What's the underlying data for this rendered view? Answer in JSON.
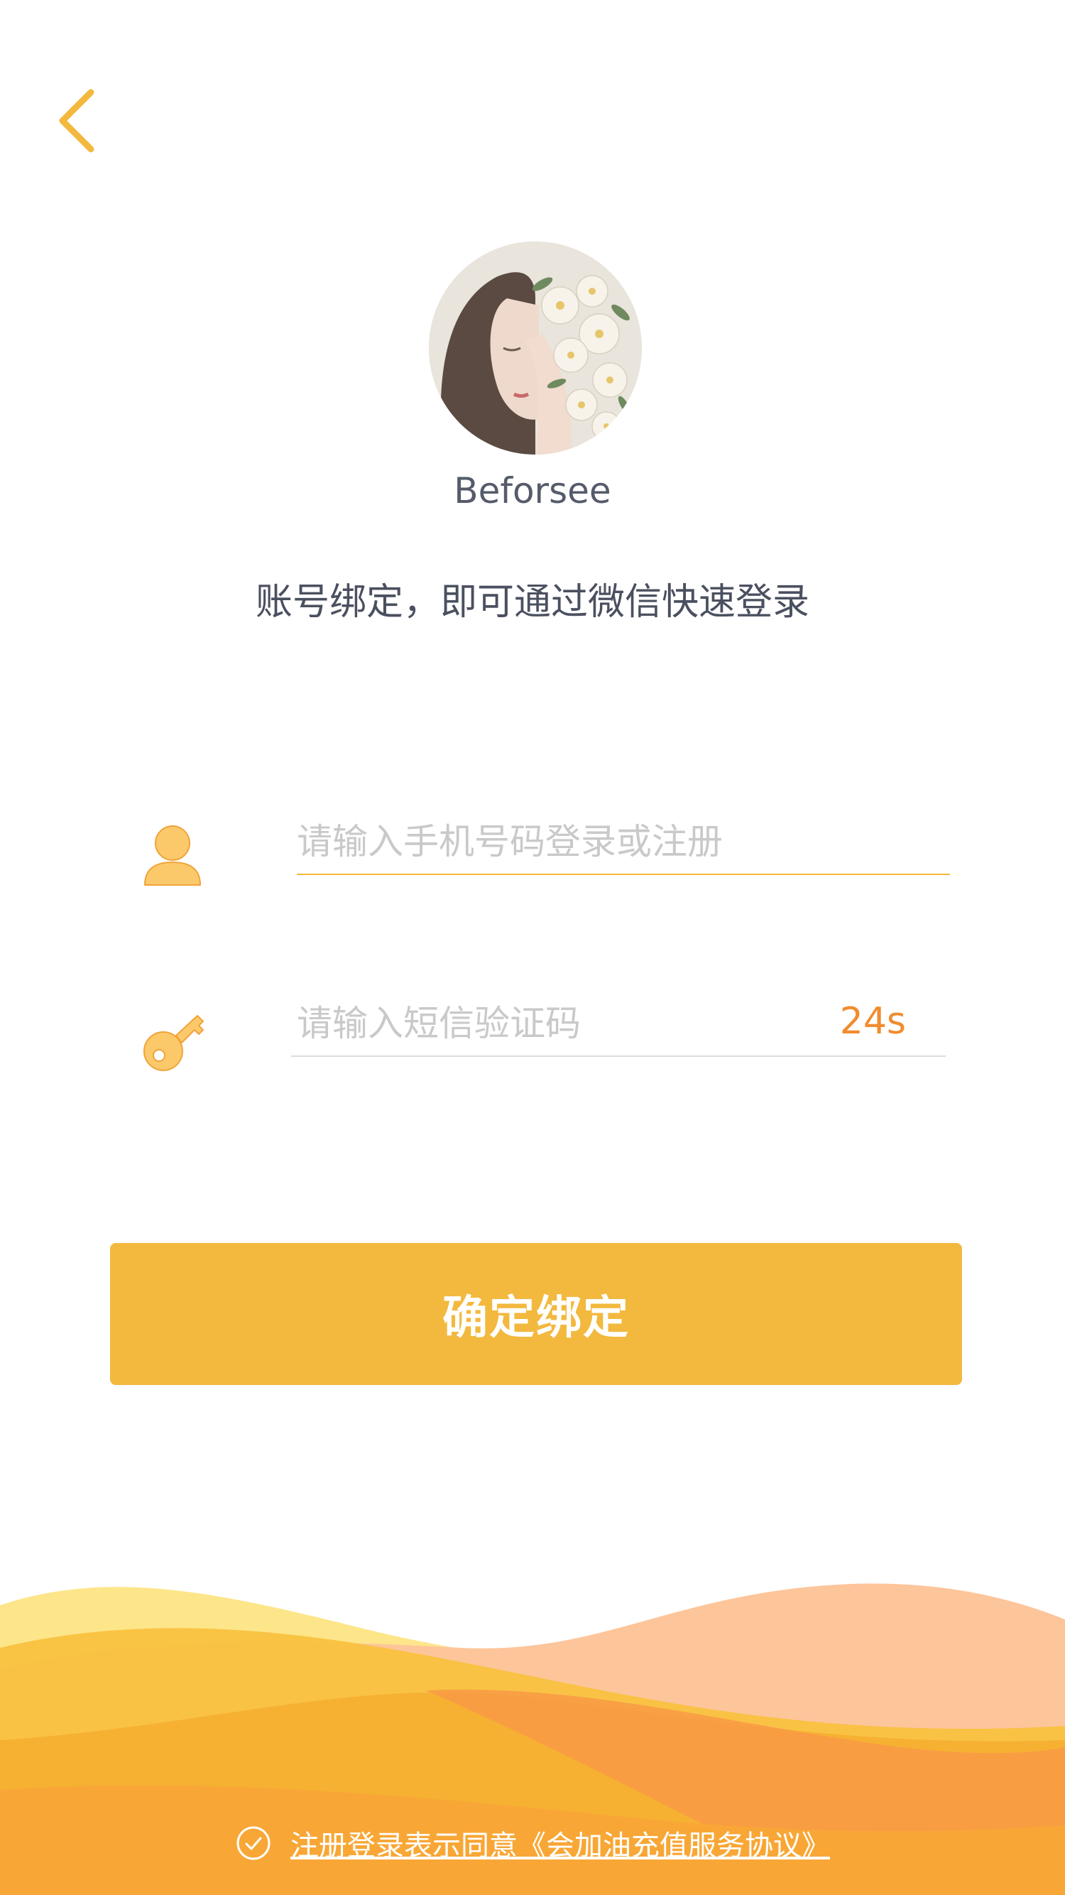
{
  "profile": {
    "username": "Beforsee"
  },
  "intro": {
    "subtitle": "账号绑定，即可通过微信快速登录"
  },
  "form": {
    "phone_placeholder": "请输入手机号码登录或注册",
    "phone_value": "",
    "code_placeholder": "请输入短信验证码",
    "code_value": "",
    "countdown": "24s"
  },
  "actions": {
    "submit_label": "确定绑定"
  },
  "footer": {
    "agreement": "注册登录表示同意《会加油充值服务协议》"
  },
  "icons": {
    "back": "chevron-left-icon",
    "phone": "user-icon",
    "code": "key-icon",
    "agree": "check-circle-icon"
  },
  "colors": {
    "accent": "#f2b93e",
    "countdown": "#f08c2e",
    "text": "#4b5060",
    "placeholder": "#c9c9c9"
  }
}
